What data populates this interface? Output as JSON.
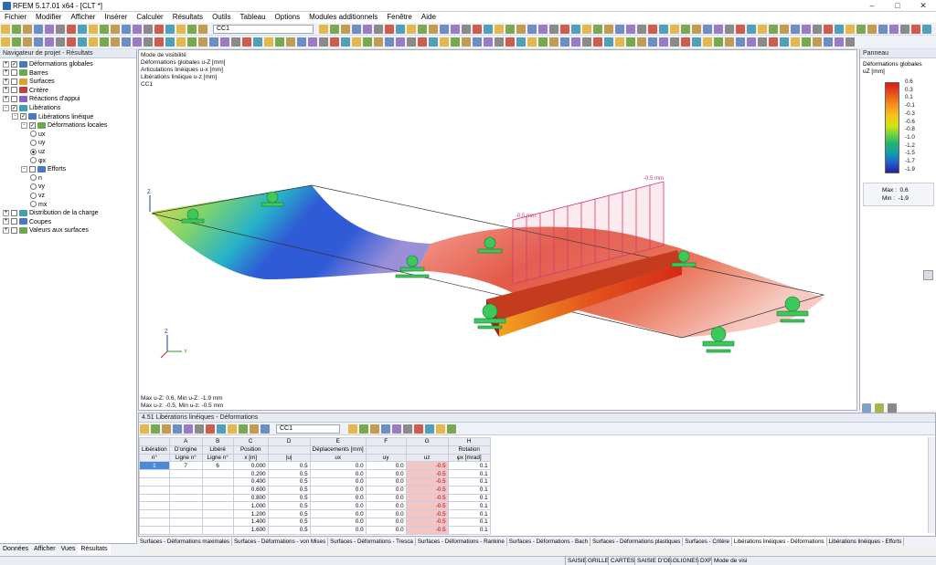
{
  "window": {
    "title": "RFEM 5.17.01 x64 - [CLT *]"
  },
  "menu": [
    "Fichier",
    "Modifier",
    "Afficher",
    "Insérer",
    "Calculer",
    "Résultats",
    "Outils",
    "Tableau",
    "Options",
    "Modules additionnels",
    "Fenêtre",
    "Aide"
  ],
  "toolbar": {
    "load_case": "CC1"
  },
  "navigator": {
    "title": "Navigateur de projet - Résultats",
    "items": [
      {
        "label": "Déformations globales",
        "level": 0,
        "checked": true,
        "exp": "+"
      },
      {
        "label": "Barres",
        "level": 0,
        "checked": false,
        "exp": "+"
      },
      {
        "label": "Surfaces",
        "level": 0,
        "checked": false,
        "exp": "+"
      },
      {
        "label": "Critère",
        "level": 0,
        "checked": false,
        "exp": "+"
      },
      {
        "label": "Réactions d'appui",
        "level": 0,
        "checked": false,
        "exp": "+"
      },
      {
        "label": "Libérations",
        "level": 0,
        "checked": true,
        "exp": "-"
      },
      {
        "label": "Libérations linéique",
        "level": 1,
        "checked": true,
        "exp": "-"
      },
      {
        "label": "Déformations locales",
        "level": 2,
        "checked": true,
        "exp": "-"
      },
      {
        "label": "ux",
        "level": 3,
        "radio": true,
        "on": false
      },
      {
        "label": "uy",
        "level": 3,
        "radio": true,
        "on": false
      },
      {
        "label": "uz",
        "level": 3,
        "radio": true,
        "on": true
      },
      {
        "label": "φx",
        "level": 3,
        "radio": true,
        "on": false
      },
      {
        "label": "Efforts",
        "level": 2,
        "checked": false,
        "exp": "-"
      },
      {
        "label": "n",
        "level": 3,
        "radio": true,
        "on": false
      },
      {
        "label": "vy",
        "level": 3,
        "radio": true,
        "on": false
      },
      {
        "label": "vz",
        "level": 3,
        "radio": true,
        "on": false
      },
      {
        "label": "mx",
        "level": 3,
        "radio": true,
        "on": false
      },
      {
        "label": "Distribution de la charge",
        "level": 0,
        "checked": false,
        "exp": "+"
      },
      {
        "label": "Coupes",
        "level": 0,
        "checked": false,
        "exp": "+"
      },
      {
        "label": "Valeurs aux surfaces",
        "level": 0,
        "checked": false,
        "exp": "+"
      }
    ],
    "tabs": [
      "Données",
      "Afficher",
      "Vues",
      "Résultats"
    ]
  },
  "view": {
    "info": [
      "Mode de visibilité",
      "Déformations globales u-Z [mm]",
      "Articulations linéiques u-x [mm]",
      "Libérations linéique u-z [mm]",
      "CC1"
    ],
    "footer": [
      "Max u-Z: 0.6, Min u-Z: -1.9 mm",
      "Max u-z: -0.5, Min u-z: -0.5 mm"
    ],
    "label_top": "-0.5 mm",
    "label_mid": "-0.5 mm"
  },
  "panel": {
    "title": "Panneau",
    "subtitle": "Déformations globales",
    "unit": "uZ [mm]",
    "legend": [
      "0.6",
      "0.3",
      "0.1",
      "-0.1",
      "-0.3",
      "-0.6",
      "-0.8",
      "-1.0",
      "-1.2",
      "-1.5",
      "-1.7",
      "-1.9"
    ],
    "max_label": "Max :",
    "max": "0.6",
    "min_label": "Min :",
    "min": "-1.9"
  },
  "table": {
    "title": "4.51 Libérations linéiques - Déformations",
    "combo": "CC1",
    "col_letters": [
      "A",
      "B",
      "C",
      "D",
      "E",
      "F",
      "G",
      "H"
    ],
    "head1": [
      "Libération",
      "D'origine",
      "Libéré",
      "Position",
      "",
      "Déplacements [mm]",
      "",
      "",
      "Rotation"
    ],
    "head2": [
      "n°",
      "Ligne n°",
      "Ligne n°",
      "x [m]",
      "|u|",
      "ux",
      "uy",
      "uz",
      "φx [mrad]"
    ],
    "rows": [
      [
        "1",
        "7",
        "6",
        "0.000",
        "0.5",
        "0.0",
        "0.0",
        "-0.5",
        "0.1"
      ],
      [
        "",
        "",
        "",
        "0.200",
        "0.5",
        "0.0",
        "0.0",
        "-0.5",
        "0.1"
      ],
      [
        "",
        "",
        "",
        "0.400",
        "0.5",
        "0.0",
        "0.0",
        "-0.5",
        "0.1"
      ],
      [
        "",
        "",
        "",
        "0.600",
        "0.5",
        "0.0",
        "0.0",
        "-0.5",
        "0.1"
      ],
      [
        "",
        "",
        "",
        "0.800",
        "0.5",
        "0.0",
        "0.0",
        "-0.5",
        "0.1"
      ],
      [
        "",
        "",
        "",
        "1.000",
        "0.5",
        "0.0",
        "0.0",
        "-0.5",
        "0.1"
      ],
      [
        "",
        "",
        "",
        "1.200",
        "0.5",
        "0.0",
        "0.0",
        "-0.5",
        "0.1"
      ],
      [
        "",
        "",
        "",
        "1.400",
        "0.5",
        "0.0",
        "0.0",
        "-0.5",
        "0.1"
      ],
      [
        "",
        "",
        "",
        "1.600",
        "0.5",
        "0.0",
        "0.0",
        "-0.5",
        "0.1"
      ]
    ]
  },
  "tabs": [
    "Surfaces - Déformations maximales",
    "Surfaces - Déformations - von Mises",
    "Surfaces - Déformations - Tresca",
    "Surfaces - Déformations - Rankine",
    "Surfaces - Déformations - Bach",
    "Surfaces - Déformations plastiques",
    "Surfaces - Critère",
    "Libérations linéiques - Déformations",
    "Libérations linéiques - Efforts"
  ],
  "status": [
    "SAISIE",
    "GRILLE",
    "CARTES",
    "SAISIE D'OB.",
    "GLIGNES",
    "DXF",
    "Mode de visi"
  ]
}
